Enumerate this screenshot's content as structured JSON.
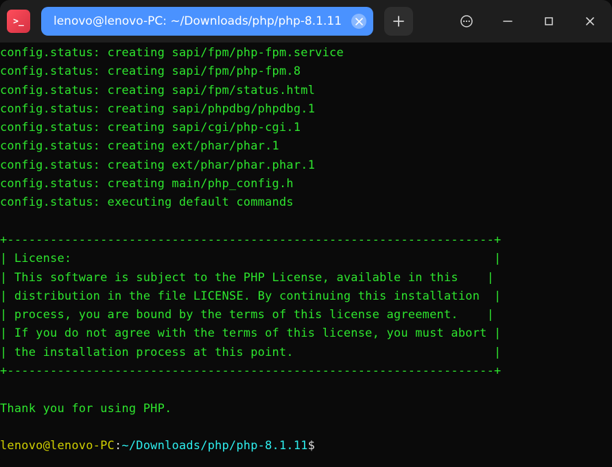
{
  "tab": {
    "title": "lenovo@lenovo-PC: ~/Downloads/php/php-8.1.11"
  },
  "terminal": {
    "lines": [
      "config.status: creating sapi/fpm/php-fpm.service",
      "config.status: creating sapi/fpm/php-fpm.8",
      "config.status: creating sapi/fpm/status.html",
      "config.status: creating sapi/phpdbg/phpdbg.1",
      "config.status: creating sapi/cgi/php-cgi.1",
      "config.status: creating ext/phar/phar.1",
      "config.status: creating ext/phar/phar.phar.1",
      "config.status: creating main/php_config.h",
      "config.status: executing default commands",
      "",
      "+--------------------------------------------------------------------+",
      "| License:                                                           |",
      "| This software is subject to the PHP License, available in this    |",
      "| distribution in the file LICENSE. By continuing this installation  |",
      "| process, you are bound by the terms of this license agreement.    |",
      "| If you do not agree with the terms of this license, you must abort |",
      "| the installation process at this point.                            |",
      "+--------------------------------------------------------------------+",
      "",
      "Thank you for using PHP.",
      ""
    ],
    "prompt": {
      "userhost": "lenovo@lenovo-PC",
      "sep": ":",
      "cwd": "~/Downloads/php/php-8.1.11",
      "sigil": "$"
    }
  }
}
